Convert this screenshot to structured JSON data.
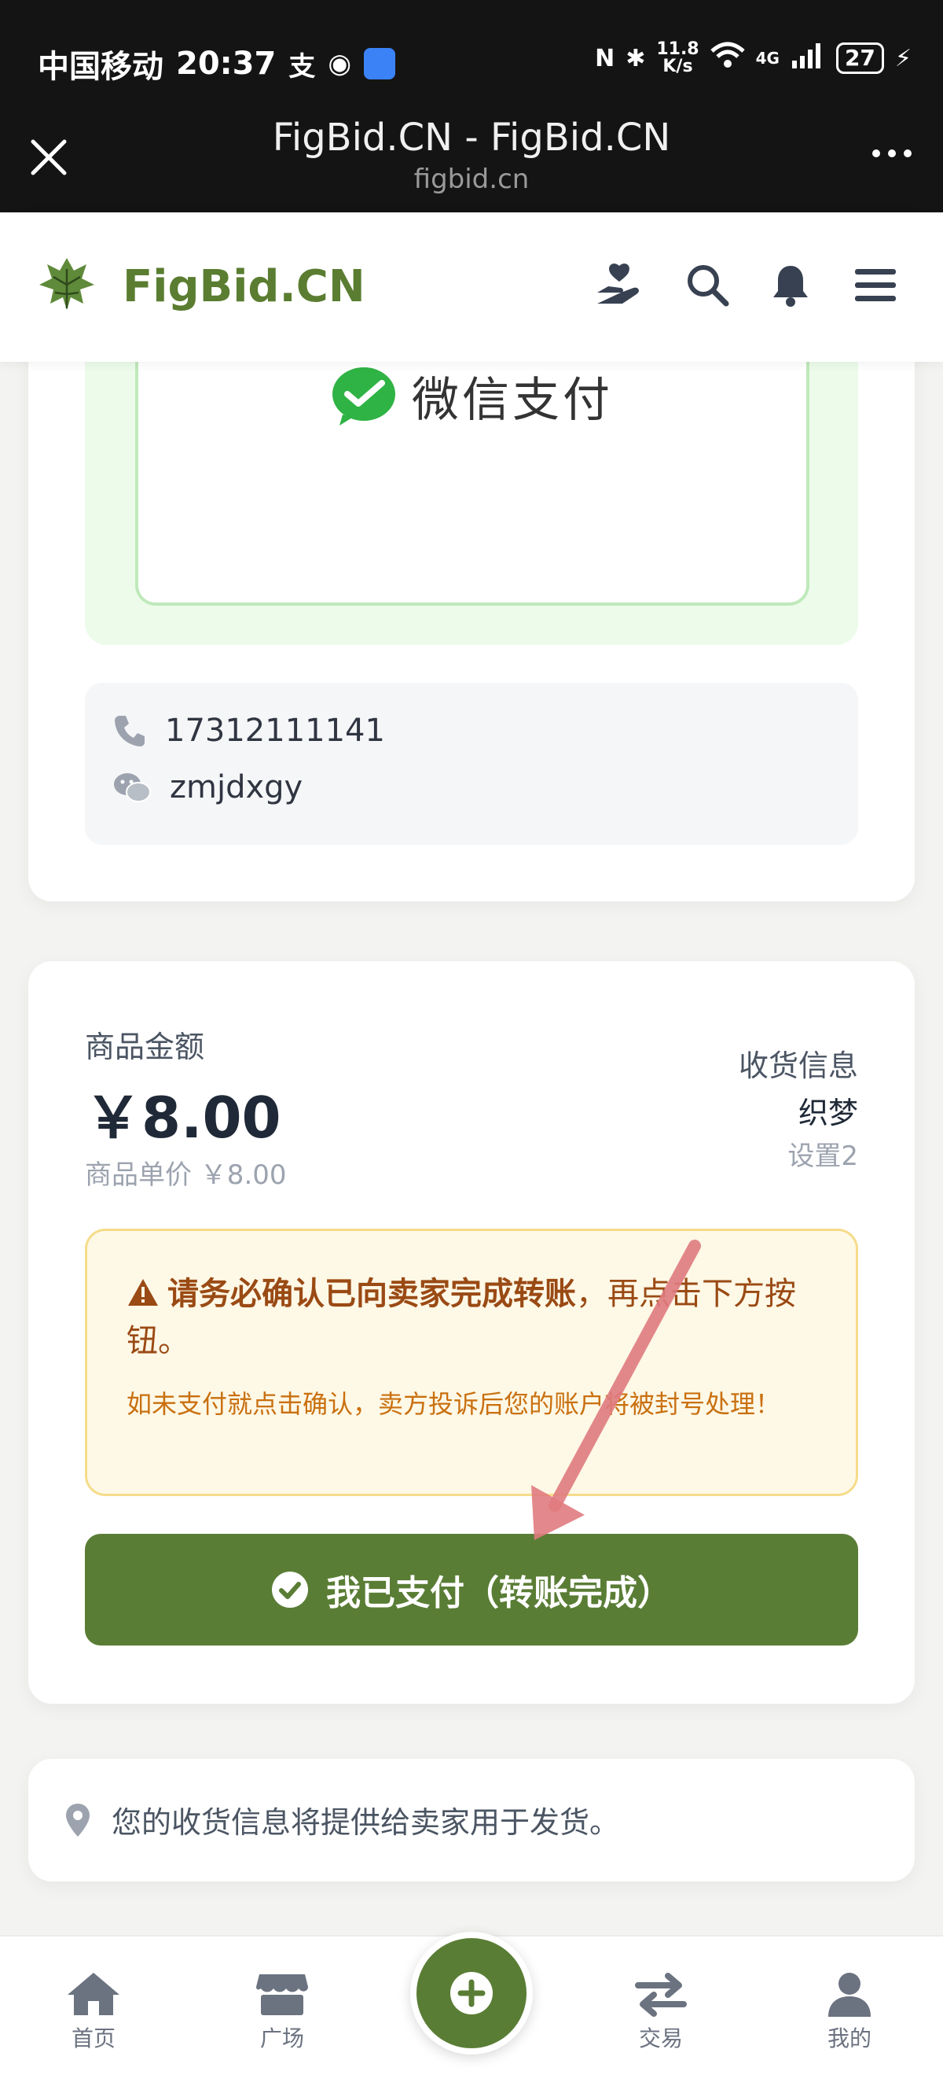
{
  "status_bar": {
    "carrier": "中国移动",
    "time": "20:37",
    "net_speed_value": "11.8",
    "net_speed_unit": "K/s",
    "signal_label": "4G",
    "battery": "27"
  },
  "browser": {
    "title": "FigBid.CN - FigBid.CN",
    "url": "figbid.cn"
  },
  "site": {
    "name": "FigBid.CN"
  },
  "payment": {
    "method_label": "微信支付",
    "phone": "17312111141",
    "wechat_id": "zmjdxgy"
  },
  "order": {
    "amount_label": "商品金额",
    "amount": "￥8.00",
    "unit_price": "商品单价 ￥8.00",
    "shipping_title": "收货信息",
    "shipping_name": "织梦",
    "shipping_note": "设置2"
  },
  "warning": {
    "strong": "请务必确认已向卖家完成转账",
    "rest": "，再点击下方按钮。",
    "sub": "如未支付就点击确认，卖方投诉后您的账户将被封号处理！"
  },
  "paid_button_label": "我已支付（转账完成）",
  "shipping_info_text": "您的收货信息将提供给卖家用于发货。",
  "nav": {
    "home": "首页",
    "plaza": "广场",
    "trade": "交易",
    "mine": "我的"
  },
  "colors": {
    "brand_green": "#5a7d35",
    "wechat_green": "#5abf69",
    "warning_bg": "#fef8e6",
    "annotation_arrow": "#e07b80"
  }
}
